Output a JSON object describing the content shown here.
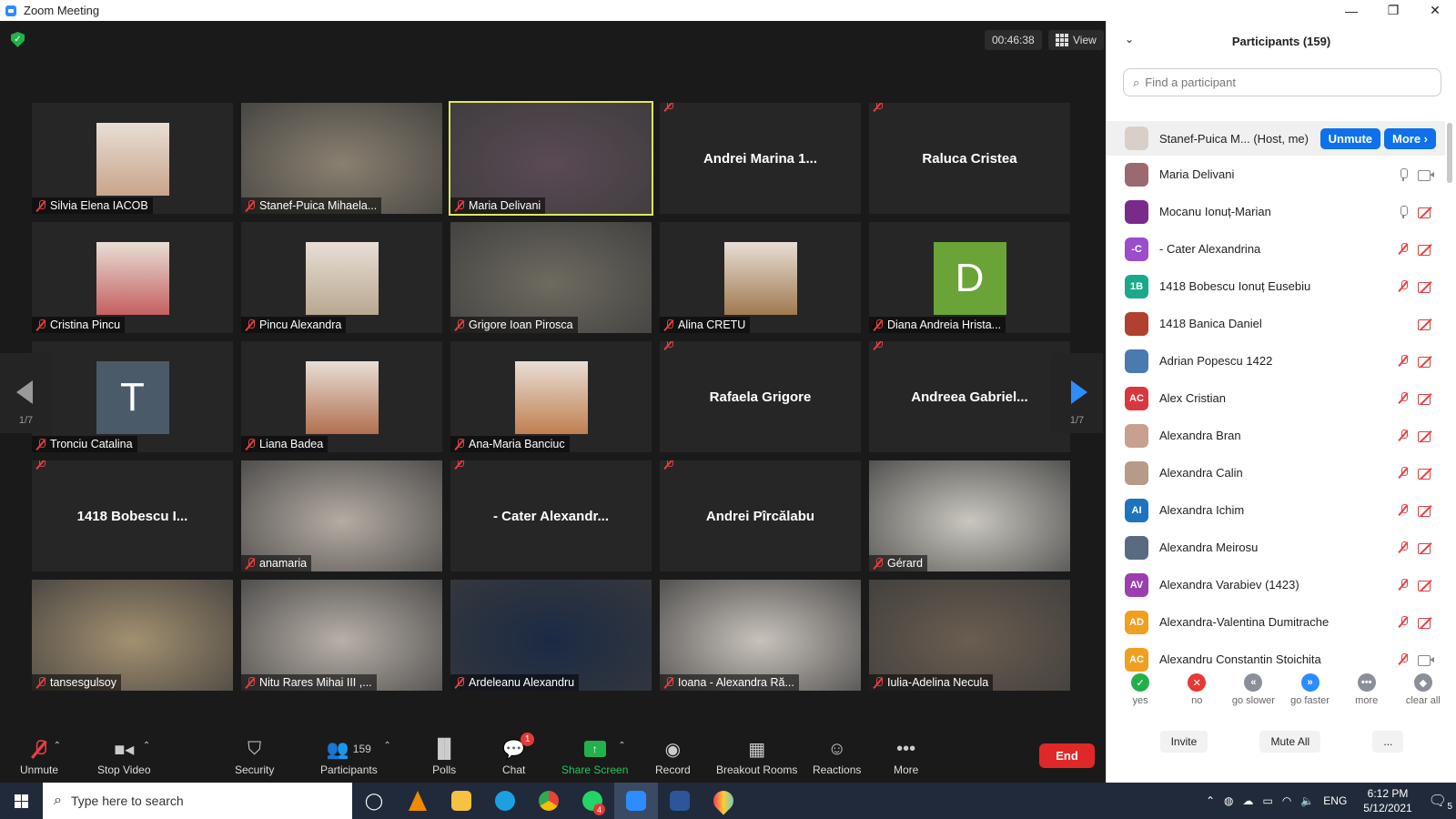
{
  "window": {
    "title": "Zoom Meeting",
    "controls": [
      "—",
      "❐",
      "✕"
    ]
  },
  "header": {
    "timer": "00:46:38",
    "view_label": "View"
  },
  "pager": {
    "left_page": "1/7",
    "right_page": "1/7"
  },
  "tiles": [
    {
      "name": "Silvia Elena IACOB",
      "kind": "photo",
      "color": "#c9a48a"
    },
    {
      "name": "Stanef-Puica Mihaela...",
      "kind": "video",
      "color": "#8a8070"
    },
    {
      "name": "Maria Delivani",
      "kind": "video",
      "color": "#5a4a55",
      "active": true
    },
    {
      "name": "Andrei  Marina  1...",
      "kind": "text"
    },
    {
      "name": "Raluca Cristea",
      "kind": "text"
    },
    {
      "name": "Cristina Pincu",
      "kind": "photo",
      "color": "#c46060"
    },
    {
      "name": "Pincu Alexandra",
      "kind": "photo",
      "color": "#b8a890"
    },
    {
      "name": "Grigore Ioan Pirosca",
      "kind": "video",
      "color": "#6e6a60"
    },
    {
      "name": "Alina CRETU",
      "kind": "photo",
      "color": "#a07a50"
    },
    {
      "name": "Diana Andreia Hrista...",
      "kind": "letter",
      "letter": "D",
      "color": "#6aa336"
    },
    {
      "name": "Tronciu Catalina",
      "kind": "letter",
      "letter": "T",
      "color": "#4a5a68"
    },
    {
      "name": "Liana Badea",
      "kind": "photo",
      "color": "#b07050"
    },
    {
      "name": "Ana-Maria Banciuc",
      "kind": "photo",
      "color": "#c08050"
    },
    {
      "name": "Rafaela Grigore",
      "kind": "text"
    },
    {
      "name": "Andreea  Gabriel...",
      "kind": "text"
    },
    {
      "name": "1418  Bobescu I...",
      "kind": "text"
    },
    {
      "name": "anamaria",
      "kind": "video",
      "color": "#b5aca3"
    },
    {
      "name": "- Cater  Alexandr...",
      "kind": "text"
    },
    {
      "name": "Andrei Pîrcălabu",
      "kind": "text"
    },
    {
      "name": "Gérard",
      "kind": "video",
      "color": "#c9c7bf"
    },
    {
      "name": "tansesgulsoy",
      "kind": "video",
      "color": "#a39070"
    },
    {
      "name": "Nitu Rares Mihai III ,...",
      "kind": "video",
      "color": "#b8b0a8"
    },
    {
      "name": "Ardeleanu Alexandru",
      "kind": "video",
      "color": "#1b2a44"
    },
    {
      "name": "Ioana - Alexandra Ră...",
      "kind": "video",
      "color": "#c8c2bb"
    },
    {
      "name": "Iulia-Adelina Necula",
      "kind": "video",
      "color": "#6a5d50"
    }
  ],
  "toolbar": {
    "unmute": "Unmute",
    "stop_video": "Stop Video",
    "security": "Security",
    "participants": "Participants",
    "participants_count": "159",
    "polls": "Polls",
    "chat": "Chat",
    "chat_badge": "1",
    "share_screen": "Share Screen",
    "record": "Record",
    "breakout": "Breakout Rooms",
    "reactions": "Reactions",
    "more": "More",
    "end": "End"
  },
  "panel": {
    "title": "Participants (159)",
    "search_placeholder": "Find a participant",
    "host": {
      "name": "Stanef-Puica M... (Host, me)",
      "unmute": "Unmute",
      "more": "More ›"
    },
    "participants": [
      {
        "name": "Maria Delivani",
        "avatar": "",
        "color": "#9a6a70",
        "mic": "on",
        "cam": "on"
      },
      {
        "name": "Mocanu Ionuț-Marian",
        "avatar": "",
        "color": "#7a2a8a",
        "mic": "on",
        "cam": "off"
      },
      {
        "name": "- Cater Alexandrina",
        "avatar": "-C",
        "color": "#9b4dca",
        "mic": "off",
        "cam": "off"
      },
      {
        "name": "1418  Bobescu Ionuț Eusebiu",
        "avatar": "1B",
        "color": "#1aaa8a",
        "mic": "off",
        "cam": "off"
      },
      {
        "name": "1418 Banica Daniel",
        "avatar": "",
        "color": "#b04030",
        "mic": "none",
        "cam": "off"
      },
      {
        "name": "Adrian Popescu 1422",
        "avatar": "",
        "color": "#4a7ab0",
        "mic": "off",
        "cam": "off"
      },
      {
        "name": "Alex Cristian",
        "avatar": "AC",
        "color": "#d9363e",
        "mic": "off",
        "cam": "off"
      },
      {
        "name": "Alexandra Bran",
        "avatar": "",
        "color": "#c8a090",
        "mic": "off",
        "cam": "off"
      },
      {
        "name": "Alexandra Calin",
        "avatar": "",
        "color": "#b89a88",
        "mic": "off",
        "cam": "off"
      },
      {
        "name": "Alexandra Ichim",
        "avatar": "AI",
        "color": "#1e73be",
        "mic": "off",
        "cam": "off"
      },
      {
        "name": "Alexandra Meirosu",
        "avatar": "",
        "color": "#5a6a80",
        "mic": "off",
        "cam": "off"
      },
      {
        "name": "Alexandra Varabiev (1423)",
        "avatar": "AV",
        "color": "#9b3fae",
        "mic": "off",
        "cam": "off"
      },
      {
        "name": "Alexandra-Valentina Dumitrache",
        "avatar": "AD",
        "color": "#f0a020",
        "mic": "off",
        "cam": "off"
      },
      {
        "name": "Alexandru Constantin Stoichita",
        "avatar": "AC",
        "color": "#f0a020",
        "mic": "off",
        "cam": "on"
      }
    ],
    "reactions": [
      {
        "label": "yes",
        "glyph": "✓",
        "color": "#23b04a"
      },
      {
        "label": "no",
        "glyph": "✕",
        "color": "#e53935"
      },
      {
        "label": "go slower",
        "glyph": "«",
        "color": "#8a8f99"
      },
      {
        "label": "go faster",
        "glyph": "»",
        "color": "#2d8cff"
      },
      {
        "label": "more",
        "glyph": "•••",
        "color": "#8a8f99"
      },
      {
        "label": "clear all",
        "glyph": "◆",
        "color": "#8a8f99"
      }
    ],
    "invite": "Invite",
    "mute_all": "Mute All",
    "more_btn": "..."
  },
  "taskbar": {
    "search_placeholder": "Type here to search",
    "lang": "ENG",
    "time": "6:12 PM",
    "date": "5/12/2021",
    "notif_count": "5",
    "whatsapp_badge": "4"
  }
}
